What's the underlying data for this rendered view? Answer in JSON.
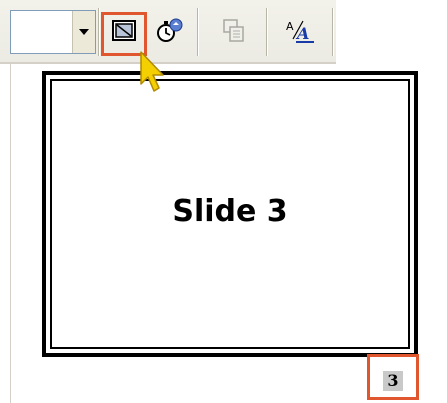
{
  "toolbar": {
    "buttons": [
      {
        "icon": "slide-show-view-icon",
        "highlighted": true
      },
      {
        "icon": "rehearse-timings-icon",
        "highlighted": false
      },
      {
        "icon": "summary-slide-icon",
        "highlighted": false,
        "disabled": true
      },
      {
        "icon": "show-formatting-icon",
        "highlighted": false
      }
    ]
  },
  "slide": {
    "title": "Slide 3",
    "number": "3"
  },
  "colors": {
    "highlight": "#e0572f",
    "cursor": "#f5d000"
  }
}
